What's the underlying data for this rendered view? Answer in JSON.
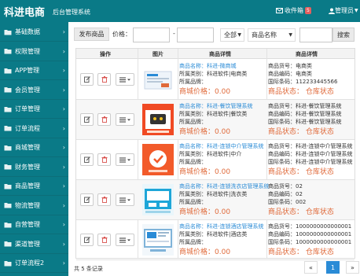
{
  "app": {
    "title": "科进电商",
    "subtitle": "后台管理系统"
  },
  "header": {
    "mail_label": "收件箱",
    "mail_count": "5",
    "admin_label": "管理员"
  },
  "sidebar": {
    "items": [
      {
        "label": "基础数据"
      },
      {
        "label": "权限管理"
      },
      {
        "label": "APP管理"
      },
      {
        "label": "会员管理"
      },
      {
        "label": "订单管理"
      },
      {
        "label": "订单流程"
      },
      {
        "label": "商城管理"
      },
      {
        "label": "财务管理"
      },
      {
        "label": "商品管理"
      },
      {
        "label": "物流管理"
      },
      {
        "label": "自营管理"
      },
      {
        "label": "渠道管理"
      },
      {
        "label": "订单流程2"
      }
    ]
  },
  "toolbar": {
    "publish_label": "发布商品",
    "price_label": "价格：",
    "price_separator": "-",
    "category_select": "全部",
    "field_select": "商品名称",
    "search_label": "搜索"
  },
  "table": {
    "headers": [
      "操作",
      "图片",
      "商品详情",
      "商品详情"
    ],
    "rows": [
      {
        "name": "商品名称：科进-微商城",
        "category": "所属类别：科进软件|电商类",
        "brand": "所属品牌：",
        "price": "商城价格：0.00",
        "code1": "商品货号：电商类",
        "code2": "商品编码：电商类",
        "code3": "国际条码：112233445566",
        "status": "商品状态：  仓库状态",
        "alt": false
      },
      {
        "name": "商品名称：科进-餐饮管理系统",
        "category": "所属类别：科进软件|餐饮类",
        "brand": "所属品牌：",
        "price": "商城价格：0.00",
        "code1": "商品货号：科进-餐饮管理系统",
        "code2": "商品编码：科进-餐饮管理系统",
        "code3": "国际条码：科进-餐饮管理系统",
        "status": "商品状态：  仓库状态",
        "alt": true
      },
      {
        "name": "商品名称：科进-连锁中介管理系统",
        "category": "所属类别：科进软件|中介",
        "brand": "所属品牌：",
        "price": "商城价格：0.00",
        "code1": "商品货号：科进-连锁中介管理系统",
        "code2": "商品编码：科进-连锁中介管理系统",
        "code3": "国际条码：科进-连锁中介管理系统",
        "status": "商品状态：  仓库状态",
        "alt": false
      },
      {
        "name": "商品名称：科进-连锁洗衣店管理系统",
        "category": "所属类别：科进软件|洗衣类",
        "brand": "所属品牌：",
        "price": "商城价格：0.00",
        "code1": "商品货号：02",
        "code2": "商品编码：02",
        "code3": "国际条码：002",
        "status": "商品状态：  仓库状态",
        "alt": true
      },
      {
        "name": "商品名称：科进-连锁酒店管理系统",
        "category": "所属类别：科进软件|酒店类",
        "brand": "所属品牌：",
        "price": "商城价格：0.00",
        "code1": "商品货号：1000000000000001",
        "code2": "商品编码：1000000000000001",
        "code3": "国际条码：1000000000000001",
        "status": "商品状态：  仓库状态",
        "alt": false
      }
    ]
  },
  "footer": {
    "count_text": "共 5 条记录",
    "prev": "«",
    "page": "1",
    "next": "»"
  },
  "colors": {
    "primary": "#0a7a87",
    "accent": "#e06a3a",
    "link": "#2a8bd6",
    "danger": "#d9534f"
  }
}
